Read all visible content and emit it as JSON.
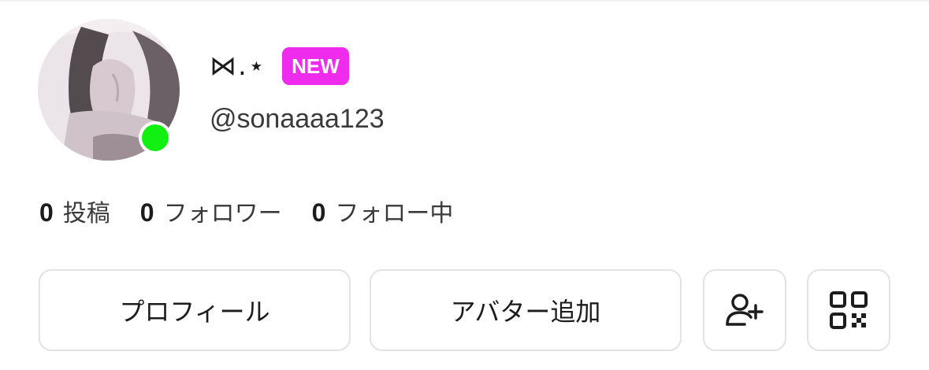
{
  "profile": {
    "display_name": "⋈.⋆",
    "new_badge": "NEW",
    "username": "@sonaaaa123",
    "online_color": "#12f012"
  },
  "stats": [
    {
      "count": "0",
      "label": "投稿"
    },
    {
      "count": "0",
      "label": "フォロワー"
    },
    {
      "count": "0",
      "label": "フォロー中"
    }
  ],
  "actions": {
    "profile_label": "プロフィール",
    "add_avatar_label": "アバター追加",
    "add_user_icon": "add-user-icon",
    "qr_icon": "qr-code-icon"
  },
  "colors": {
    "badge": "#ef2ced",
    "online": "#12f012",
    "button_border": "#e3e3e5"
  }
}
